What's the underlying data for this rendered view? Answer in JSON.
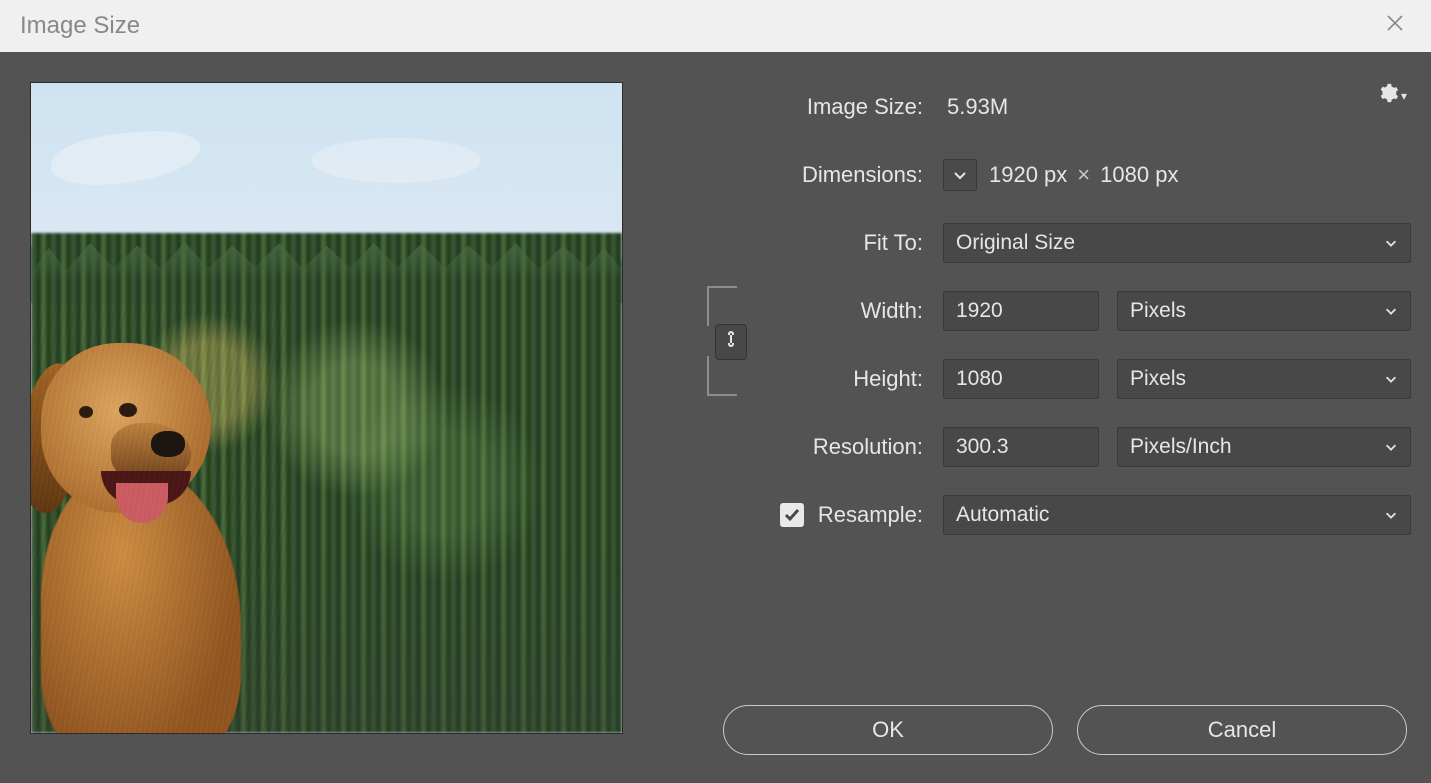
{
  "titlebar": {
    "title": "Image Size"
  },
  "info": {
    "image_size_label": "Image Size:",
    "image_size_value": "5.93M",
    "dimensions_label": "Dimensions:",
    "dimensions_w": "1920 px",
    "dimensions_h": "1080 px",
    "dimensions_sep": "×"
  },
  "fit": {
    "label": "Fit To:",
    "value": "Original Size"
  },
  "width": {
    "label": "Width:",
    "value": "1920",
    "unit": "Pixels"
  },
  "height": {
    "label": "Height:",
    "value": "1080",
    "unit": "Pixels"
  },
  "resolution": {
    "label": "Resolution:",
    "value": "300.3",
    "unit": "Pixels/Inch"
  },
  "resample": {
    "label": "Resample:",
    "checked": true,
    "value": "Automatic"
  },
  "buttons": {
    "ok": "OK",
    "cancel": "Cancel"
  }
}
